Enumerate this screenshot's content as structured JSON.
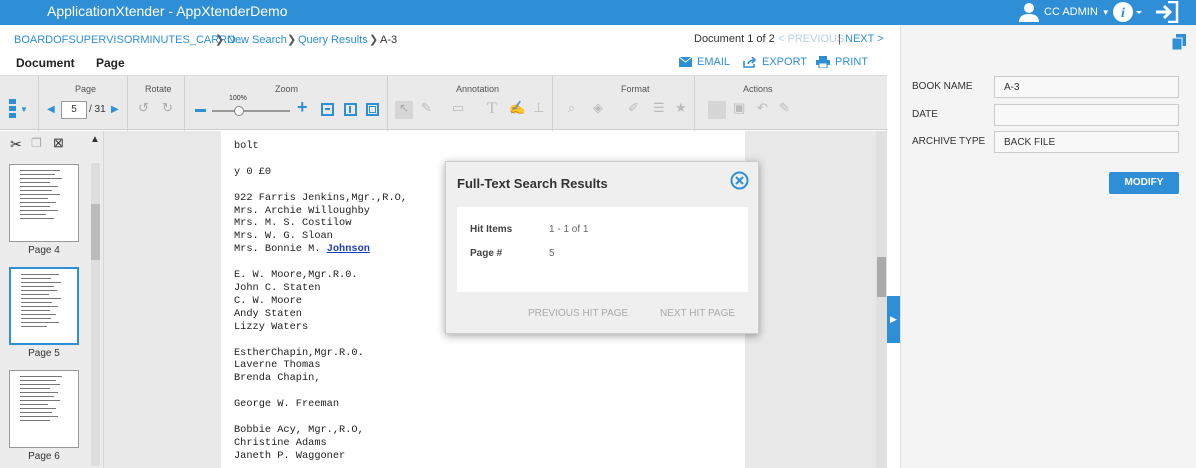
{
  "topbar": {
    "app_name": "ApplicationXtender",
    "separator": " - ",
    "app_db": "AppXtenderDemo",
    "user_name": "CC ADMIN",
    "icons": [
      "user-icon",
      "info-icon",
      "logout-icon"
    ],
    "color": "#2e8fd6"
  },
  "breadcrumb": {
    "items": [
      "BOARDOFSUPERVISORMINUTES_CARRO ...",
      "New Search",
      "Query Results",
      "A-3"
    ]
  },
  "docnav": {
    "position": "Document 1 of 2",
    "previous": "< PREVIOUS",
    "divider": "|",
    "next": "NEXT >"
  },
  "menu": {
    "document": "Document",
    "page": "Page",
    "email": "EMAIL",
    "export": "EXPORT",
    "print": "PRINT"
  },
  "toolbar": {
    "page_label": "Page",
    "page_value": "5",
    "page_total": "/ 31",
    "rotate_label": "Rotate",
    "zoom_label": "Zoom",
    "zoom_value": "100%",
    "annotation_label": "Annotation",
    "format_label": "Format",
    "actions_label": "Actions"
  },
  "thumbnails": [
    {
      "label": "Page 4"
    },
    {
      "label": "Page 5"
    },
    {
      "label": "Page 6"
    }
  ],
  "document_text": [
    "bolt",
    "",
    "y 0 £0",
    "",
    "922 Farris Jenkins,Mgr.,R.O,",
    "Mrs. Archie Willoughby",
    "Mrs. M. S. Costilow",
    "Mrs. W. G. Sloan",
    "Mrs. Bonnie M. ",
    "",
    "E. W. Moore,Mgr.R.0.",
    "John C. Staten",
    "C. W. Moore",
    "Andy Staten",
    "Lizzy Waters",
    "",
    "EstherChapin,Mgr.R.0.",
    "Laverne Thomas",
    "Brenda Chapin,",
    "",
    "George W. Freeman",
    "",
    "Bobbie Acy, Mgr.,R.O,",
    "Christine Adams",
    "Janeth P. Waggoner"
  ],
  "highlight": "Johnson",
  "dialog": {
    "title": "Full-Text Search Results",
    "hit_items_label": "Hit Items",
    "hit_items_value": "1 - 1 of 1",
    "page_label": "Page #",
    "page_value": "5",
    "prev_hit": "PREVIOUS HIT PAGE",
    "next_hit": "NEXT HIT PAGE"
  },
  "index_panel": {
    "fields": [
      {
        "label": "BOOK NAME",
        "value": "A-3"
      },
      {
        "label": "DATE",
        "value": ""
      },
      {
        "label": "ARCHIVE TYPE",
        "value": "BACK FILE"
      }
    ],
    "modify": "MODIFY"
  }
}
